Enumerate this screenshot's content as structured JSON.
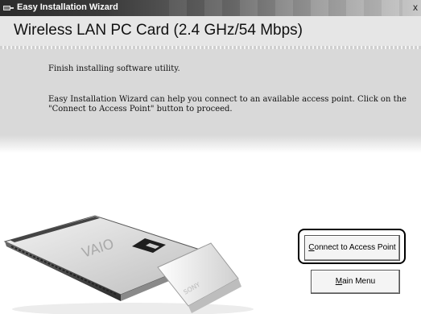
{
  "window": {
    "title": "Easy Installation Wizard"
  },
  "header": {
    "product_title": "Wireless LAN PC Card (2.4 GHz/54 Mbps)"
  },
  "content": {
    "message_1": "Finish installing software utility.",
    "message_2": "Easy Installation Wizard can help you connect to an available access point. Click on the \"Connect to Access Point\" button to proceed."
  },
  "illustration": {
    "brand": "SONY",
    "product_logo": "VAIO"
  },
  "buttons": {
    "connect_prefix": "C",
    "connect_rest": "onnect to Access Point",
    "main_prefix": "M",
    "main_rest": "ain Menu"
  }
}
